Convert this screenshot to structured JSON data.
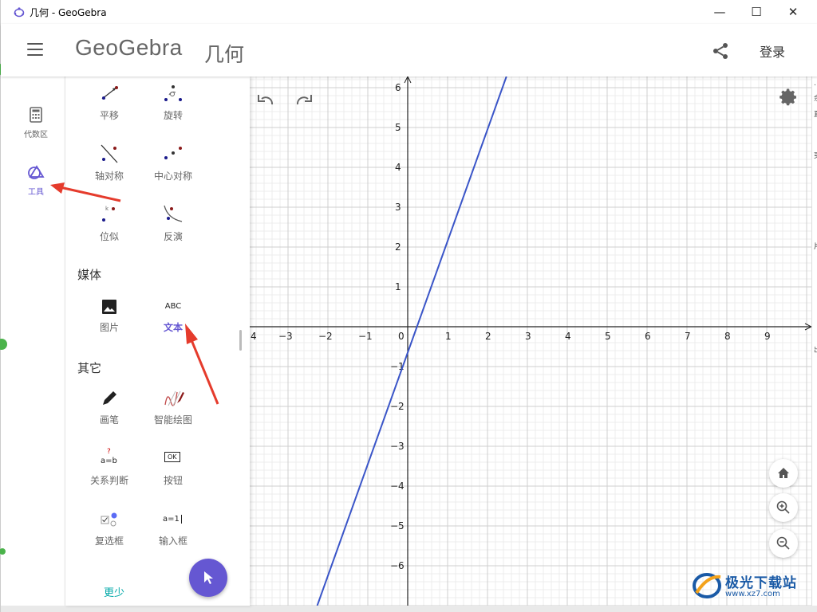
{
  "window": {
    "title": "几何 - GeoGebra",
    "min": "—",
    "max": "☐",
    "close": "✕"
  },
  "header": {
    "menu_icon": "hamburger-icon",
    "logo": "GeoGebra",
    "title": "几何",
    "share_icon": "share-icon",
    "login": "登录"
  },
  "rail": {
    "items": [
      {
        "label": "代数区",
        "icon": "calculator-icon"
      },
      {
        "label": "工具",
        "icon": "tools-icon"
      }
    ]
  },
  "panel": {
    "transform_tools": [
      {
        "label": "平移"
      },
      {
        "label": "旋转"
      },
      {
        "label": "轴对称"
      },
      {
        "label": "中心对称"
      },
      {
        "label": "位似"
      },
      {
        "label": "反演"
      }
    ],
    "media_section": "媒体",
    "media_tools": [
      {
        "label": "图片"
      },
      {
        "label": "文本",
        "icon_text": "ABC"
      }
    ],
    "other_section": "其它",
    "other_tools": [
      {
        "label": "画笔"
      },
      {
        "label": "智能绘图"
      },
      {
        "label": "关系判断",
        "icon_text": "a=b"
      },
      {
        "label": "按钮",
        "icon_text": "OK"
      },
      {
        "label": "复选框"
      },
      {
        "label": "输入框",
        "icon_text": "a=1"
      }
    ],
    "more": "更少"
  },
  "graph": {
    "x_ticks": [
      "4",
      "−3",
      "−2",
      "−1",
      "0",
      "1",
      "2",
      "3",
      "4",
      "5",
      "6",
      "7",
      "8",
      "9"
    ],
    "y_ticks_pos": [
      "6",
      "5",
      "4",
      "3",
      "2",
      "1"
    ],
    "y_ticks_neg": [
      "−1",
      "−2",
      "−3",
      "−4",
      "−5",
      "−6"
    ],
    "line_color": "#3a55c8",
    "line": {
      "slope": 2.8,
      "intercept": -0.65
    }
  },
  "right_strip": {
    "chars": [
      "…",
      "余",
      "直",
      "夷",
      "片",
      "出"
    ]
  },
  "watermark": {
    "name": "极光下载站",
    "url": "www.xz7.com"
  },
  "colors": {
    "accent": "#6557d2",
    "more_link": "#00a8a8",
    "annotation": "#e53b2c"
  }
}
